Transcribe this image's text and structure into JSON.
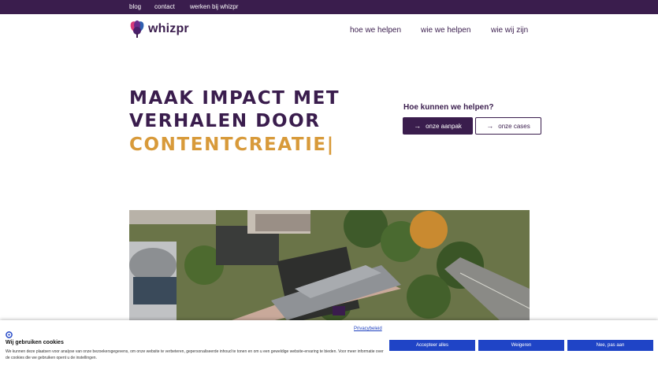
{
  "topbar": {
    "links": [
      "blog",
      "contact",
      "werken bij whizpr"
    ]
  },
  "brand": {
    "name": "whizpr"
  },
  "nav": {
    "items": [
      "hoe we helpen",
      "wie we helpen",
      "wie wij zijn"
    ]
  },
  "hero": {
    "line1": "MAAK IMPACT MET",
    "line2": "VERHALEN DOOR",
    "line3": "CONTENTCREATIE|",
    "question": "Hoe kunnen we helpen?",
    "buttons": [
      "onze aanpak",
      "onze cases"
    ]
  },
  "cookie": {
    "policy_link": "Privacybeleid",
    "title": "Wij gebruiken cookies",
    "text": "We kunnen deze plaatsen voor analyse van onze bezoekersgegevens, om onze website te verbeteren, gepersonaliseerde inhoud te tonen en om u een geweldige website-ervaring te bieden. Voor meer informatie over de cookies die we gebruiken opent u de instellingen.",
    "buttons": [
      "Accepteer alles",
      "Weigeren",
      "Nee, pas aan"
    ]
  },
  "colors": {
    "brand_purple": "#3a1d4d",
    "accent_gold": "#d89a3a",
    "cookie_blue": "#1f44c6"
  }
}
